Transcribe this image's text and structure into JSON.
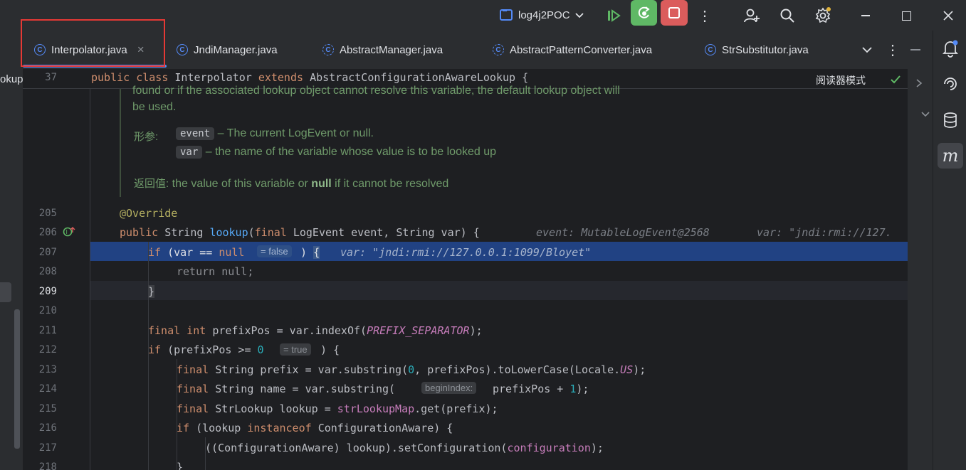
{
  "titlebar": {
    "project_name": "log4j2POC",
    "icons": [
      "project-icon",
      "chevron-down-icon",
      "resume-icon",
      "debug-refresh-icon",
      "stop-icon",
      "more-vert-icon",
      "add-user-icon",
      "search-icon",
      "settings-icon",
      "minimize-icon",
      "maximize-icon",
      "close-icon"
    ]
  },
  "tabs": [
    {
      "label": "Interpolator.java",
      "active": true
    },
    {
      "label": "JndiManager.java",
      "active": false
    },
    {
      "label": "AbstractManager.java",
      "active": false
    },
    {
      "label": "AbstractPatternConverter.java",
      "active": false
    },
    {
      "label": "StrSubstitutor.java",
      "active": false
    }
  ],
  "tab_close_glyph": "×",
  "left_panel_text": "okup",
  "sticky": {
    "line_num": "37",
    "reader_mode": "阅读器模式"
  },
  "doc": {
    "line1": "found or if the associated lookup object cannot resolve this variable, the default lookup object will",
    "line2": "be used.",
    "params_label": "形参:",
    "param1_name": "event",
    "param1_desc": "– The current LogEvent or null.",
    "param2_name": "var",
    "param2_desc": "– the name of the variable whose value is to be looked up",
    "return_label": "返回值:",
    "return_pre": "the value of this variable or ",
    "return_null": "null",
    "return_post": " if it cannot be resolved"
  },
  "lines": {
    "n205": "205",
    "n206": "206",
    "n207": "207",
    "n208": "208",
    "n209": "209",
    "n210": "210",
    "n211": "211",
    "n212": "212",
    "n213": "213",
    "n214": "214",
    "n215": "215",
    "n216": "216",
    "n217": "217",
    "n218": "218"
  },
  "hints": {
    "event_hint": "event: MutableLogEvent@2568",
    "var_hint1": "var: \"jndi:rmi://127.",
    "var_hint2": "var: \"jndi:rmi://127.0.0.1:1099/Bloyet\"",
    "false_hint": "= false",
    "true_hint": "= true",
    "begin_index": "beginIndex:"
  },
  "colors": {
    "accent": "#548af7",
    "highlight_line": "#214283",
    "stop_button": "#db5c5c",
    "debug_button": "#5fb865",
    "red_box": "#e53935"
  }
}
